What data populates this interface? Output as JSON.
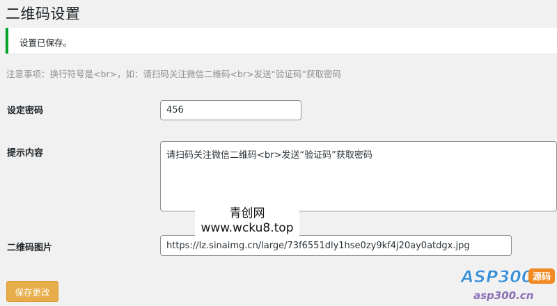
{
  "page": {
    "title": "二维码设置"
  },
  "notice": {
    "text": "设置已保存。"
  },
  "hint": {
    "text": "注意事项：换行符号是<br>，如：请扫码关注微信二维码<br>发送“验证码”获取密码"
  },
  "form": {
    "password": {
      "label": "设定密码",
      "value": "456"
    },
    "prompt": {
      "label": "提示内容",
      "value": "请扫码关注微信二维码<br>发送“验证码”获取密码"
    },
    "qr_image": {
      "label": "二维码图片",
      "value": "https://lz.sinaimg.cn/large/73f6551dly1hse0zy9kf4j20ay0atdgx.jpg"
    },
    "save_label": "保存更改"
  },
  "watermark": {
    "line1": "青创网",
    "line2": "www.wcku8.top"
  },
  "logo": {
    "main": "ASP300",
    "badge": "源码",
    "domain": "asp300.cn",
    "colors": {
      "main": "#3a8fd6",
      "badge": "#f08a24",
      "domain": "#8a6fb5"
    }
  },
  "colors": {
    "notice_accent": "#00a32a",
    "button": "#e7ad4b"
  }
}
